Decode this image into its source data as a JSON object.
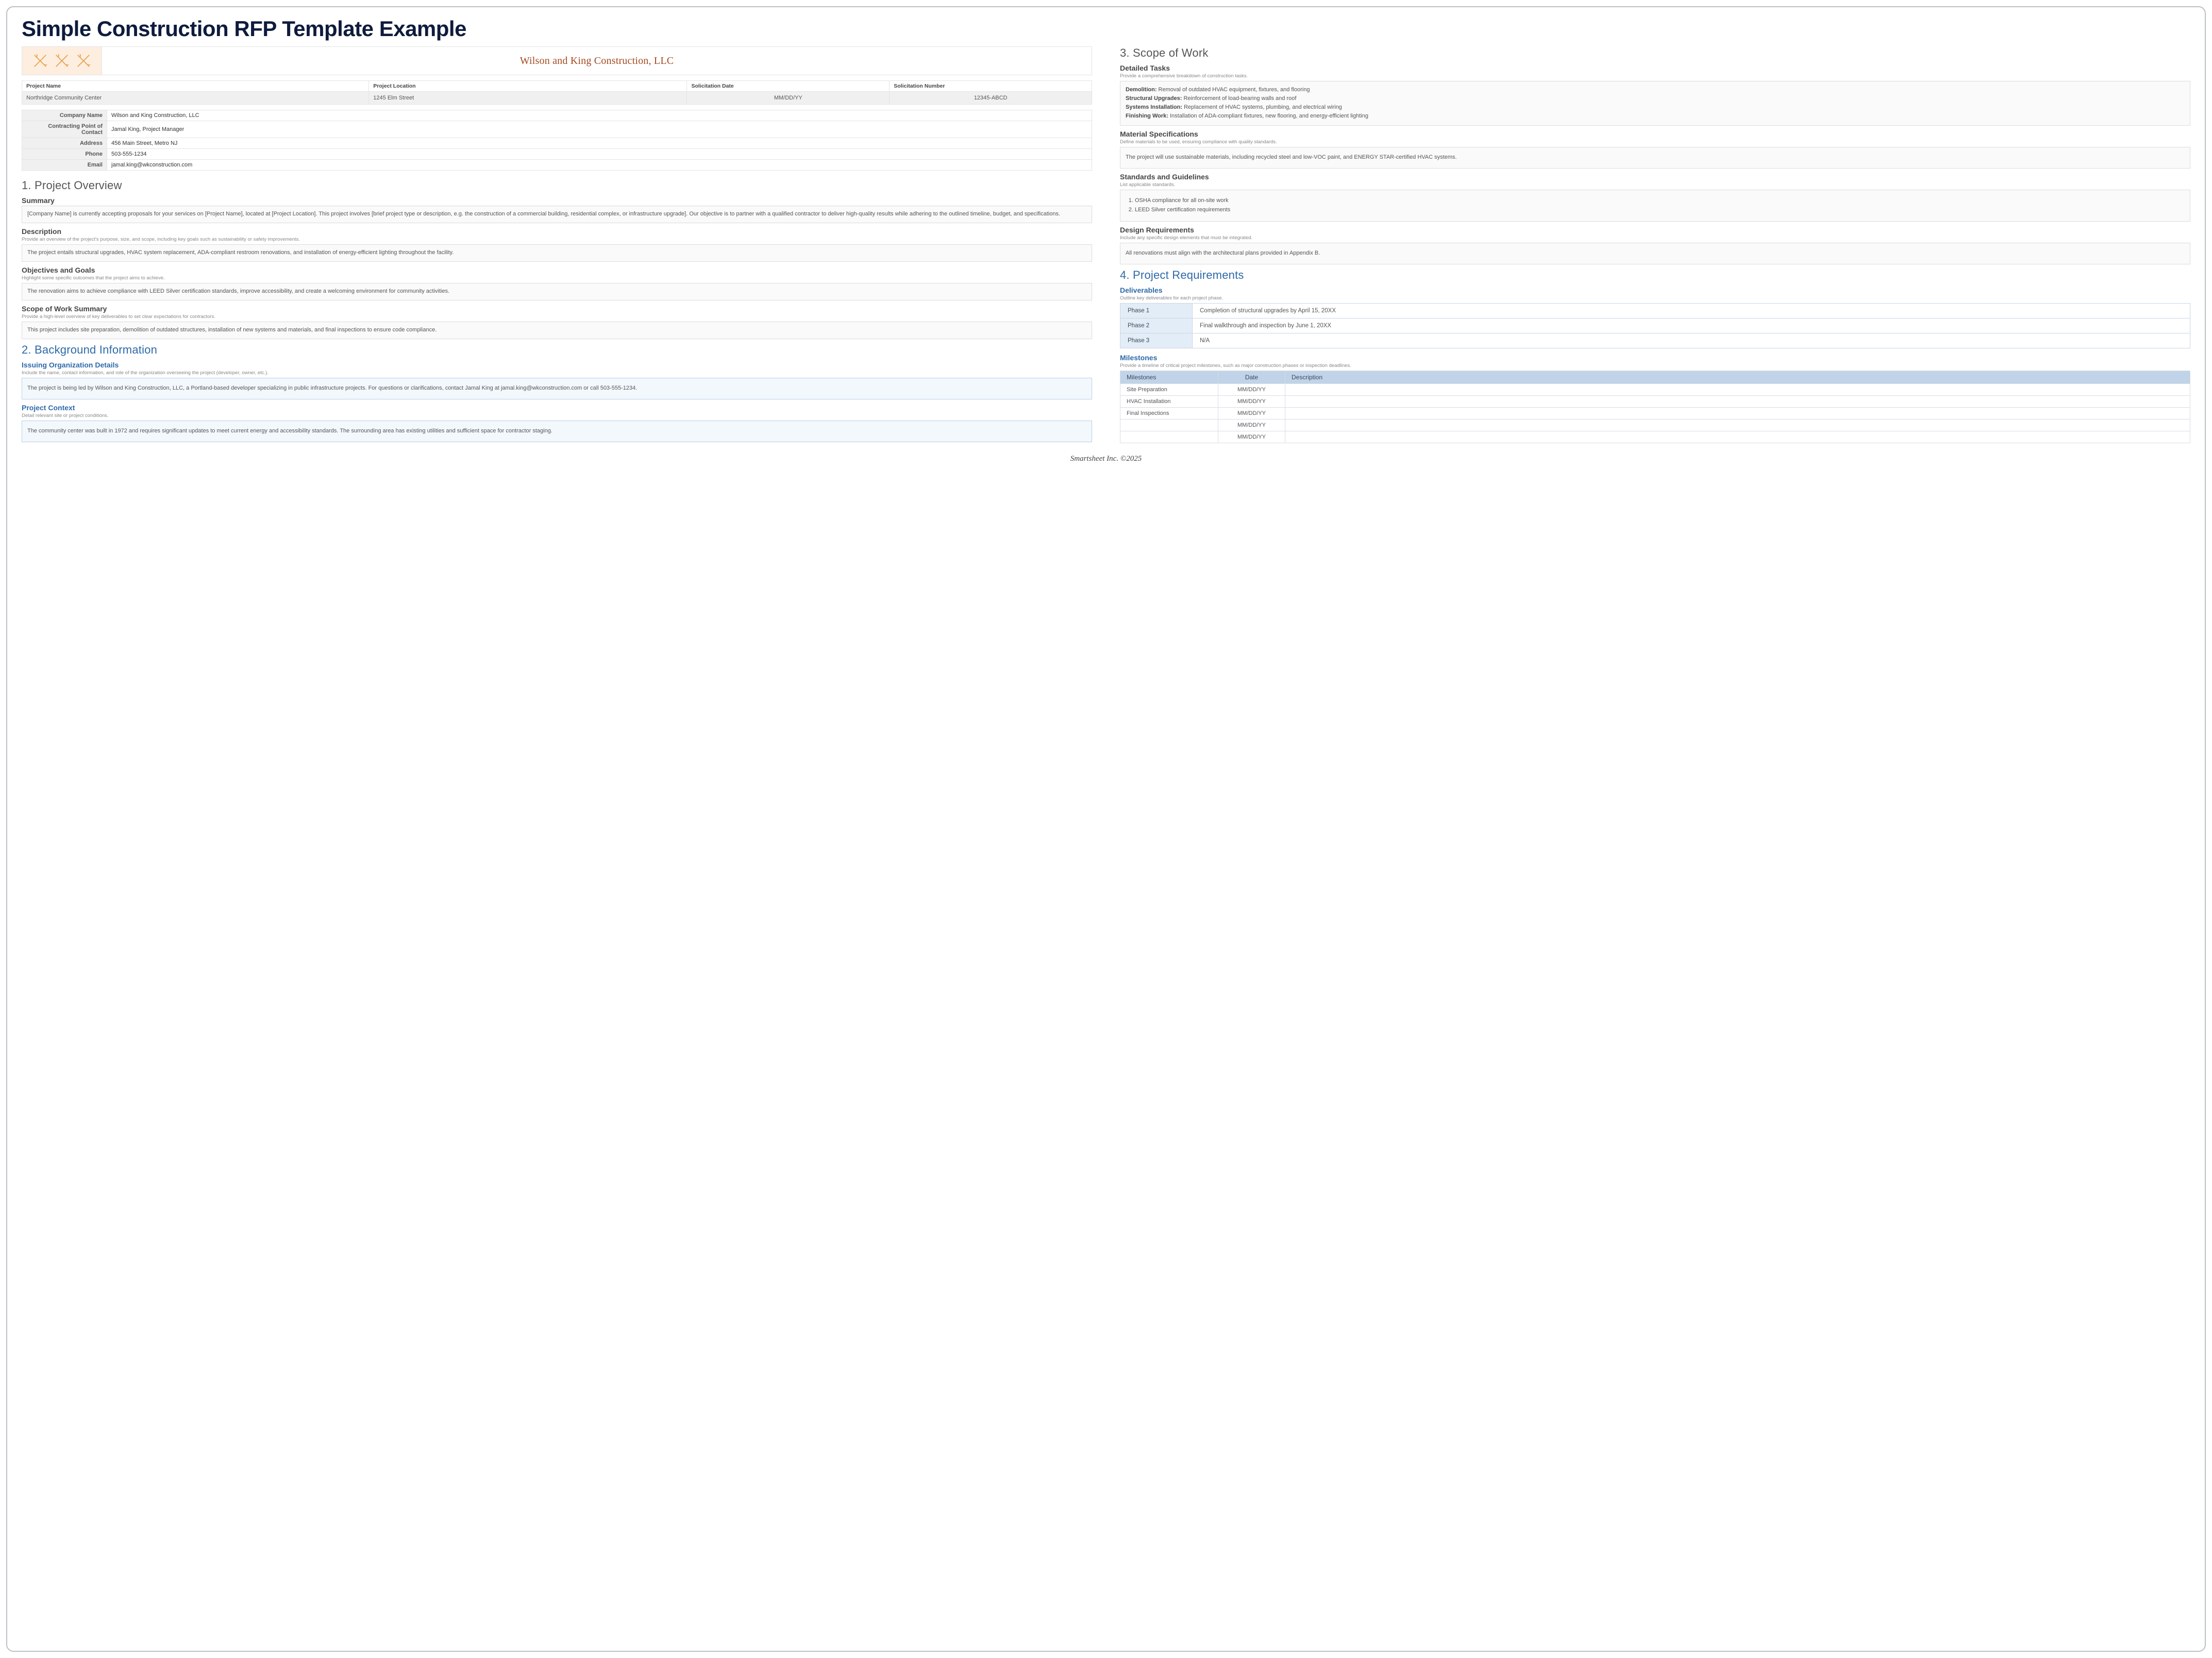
{
  "title": "Simple Construction RFP Template Example",
  "brand_name": "Wilson and King Construction, LLC",
  "project_info": {
    "headers": [
      "Project Name",
      "Project Location",
      "Solicitation Date",
      "Solicitation Number"
    ],
    "values": [
      "Northridge Community Center",
      "1245 Elm Street",
      "MM/DD/YY",
      "12345-ABCD"
    ]
  },
  "company": [
    {
      "label": "Company Name",
      "value": "Wilson and King Construction, LLC"
    },
    {
      "label": "Contracting Point of Contact",
      "value": "Jamal King, Project Manager"
    },
    {
      "label": "Address",
      "value": "456 Main Street, Metro NJ"
    },
    {
      "label": "Phone",
      "value": "503-555-1234"
    },
    {
      "label": "Email",
      "value": "jamal.king@wkconstruction.com"
    }
  ],
  "sec1": {
    "heading": "1. Project Overview",
    "summary": {
      "title": "Summary",
      "body": "[Company Name] is currently accepting proposals for your services on [Project Name], located at [Project Location]. This project involves [brief project type or description, e.g. the construction of a commercial building, residential complex, or infrastructure upgrade]. Our objective is to partner with a qualified contractor to deliver high-quality results while adhering to the outlined timeline, budget, and specifications."
    },
    "description": {
      "title": "Description",
      "hint": "Provide an overview of the project's purpose, size, and scope, including key goals such as sustainability or safety improvements.",
      "body": "The project entails structural upgrades, HVAC system replacement, ADA-compliant restroom renovations, and installation of energy-efficient lighting throughout the facility."
    },
    "objectives": {
      "title": "Objectives and Goals",
      "hint": "Highlight some specific outcomes that the project aims to achieve.",
      "body": "The renovation aims to achieve compliance with LEED Silver certification standards, improve accessibility, and create a welcoming environment for community activities."
    },
    "sow": {
      "title": "Scope of Work Summary",
      "hint": "Provide a high-level overview of key deliverables to set clear expectations for contractors.",
      "body": "This project includes site preparation, demolition of outdated structures, installation of new systems and materials, and final inspections to ensure code compliance."
    }
  },
  "sec2": {
    "heading": "2. Background Information",
    "org": {
      "title": "Issuing Organization Details",
      "hint": "Include the name, contact information, and role of the organization overseeing the project (developer, owner, etc.).",
      "body": "The project is being led by Wilson and King Construction, LLC, a Portland-based developer specializing in public infrastructure projects. For questions or clarifications, contact Jamal King at jamal.king@wkconstruction.com or call 503-555-1234."
    },
    "context": {
      "title": "Project Context",
      "hint": "Detail relevant site or project conditions.",
      "body": "The community center was built in 1972 and requires significant updates to meet current energy and accessibility standards. The surrounding area has existing utilities and sufficient space for contractor staging."
    }
  },
  "sec3": {
    "heading": "3. Scope of Work",
    "tasks": {
      "title": "Detailed Tasks",
      "hint": "Provide a comprehensive breakdown of construction tasks.",
      "items": [
        {
          "k": "Demolition:",
          "v": " Removal of outdated HVAC equipment, fixtures, and flooring"
        },
        {
          "k": "Structural Upgrades:",
          "v": " Reinforcement of load-bearing walls and roof"
        },
        {
          "k": "Systems Installation:",
          "v": " Replacement of HVAC systems, plumbing, and electrical wiring"
        },
        {
          "k": "Finishing Work:",
          "v": " Installation of ADA-compliant fixtures, new flooring, and energy-efficient lighting"
        }
      ]
    },
    "materials": {
      "title": "Material Specifications",
      "hint": "Define materials to be used, ensuring compliance with quality standards.",
      "body": "The project will use sustainable materials, including recycled steel and low-VOC paint, and ENERGY STAR-certified HVAC systems."
    },
    "standards": {
      "title": "Standards and Guidelines",
      "hint": "List applicable standards.",
      "items": [
        "OSHA compliance for all on-site work",
        "LEED Silver certification requirements"
      ]
    },
    "design": {
      "title": "Design Requirements",
      "hint": "Include any specific design elements that must be integrated.",
      "body": "All renovations must align with the architectural plans provided in Appendix B."
    }
  },
  "sec4": {
    "heading": "4. Project Requirements",
    "deliverables": {
      "title": "Deliverables",
      "hint": "Outline key deliverables for each project phase.",
      "rows": [
        {
          "phase": "Phase 1",
          "desc": "Completion of structural upgrades by April 15, 20XX"
        },
        {
          "phase": "Phase 2",
          "desc": "Final walkthrough and inspection by June 1, 20XX"
        },
        {
          "phase": "Phase 3",
          "desc": "N/A"
        }
      ]
    },
    "milestones": {
      "title": "Milestones",
      "hint": "Provide a timeline of critical project milestones, such as major construction phases or inspection deadlines.",
      "headers": [
        "Milestones",
        "Date",
        "Description"
      ],
      "rows": [
        {
          "name": "Site Preparation",
          "date": "MM/DD/YY",
          "desc": ""
        },
        {
          "name": "HVAC Installation",
          "date": "MM/DD/YY",
          "desc": ""
        },
        {
          "name": "Final Inspections",
          "date": "MM/DD/YY",
          "desc": ""
        },
        {
          "name": "",
          "date": "MM/DD/YY",
          "desc": ""
        },
        {
          "name": "",
          "date": "MM/DD/YY",
          "desc": ""
        }
      ]
    }
  },
  "footer": "Smartsheet Inc. ©2025"
}
